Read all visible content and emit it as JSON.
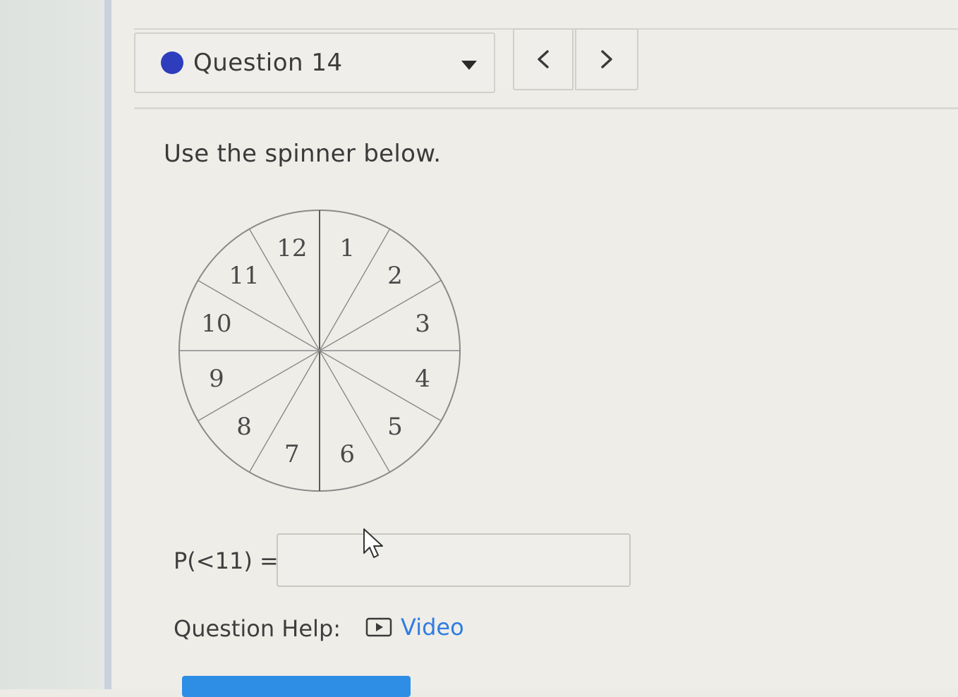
{
  "question_header": {
    "title": "Question 14",
    "status_color": "#2e3dbd",
    "dropdown_icon": "caret-down-icon",
    "prev_icon": "chevron-left-icon",
    "next_icon": "chevron-right-icon"
  },
  "question": {
    "instruction": "Use the spinner below.",
    "spinner_sections": [
      "12",
      "1",
      "2",
      "3",
      "4",
      "5",
      "6",
      "7",
      "8",
      "9",
      "10",
      "11"
    ],
    "prompt_label": "P(<11) =",
    "answer_value": ""
  },
  "help": {
    "label": "Question Help:",
    "video_label": "Video",
    "video_icon": "play-video-icon",
    "link_color": "#2f7de1"
  },
  "submit_button_color": "#2e8ee6"
}
